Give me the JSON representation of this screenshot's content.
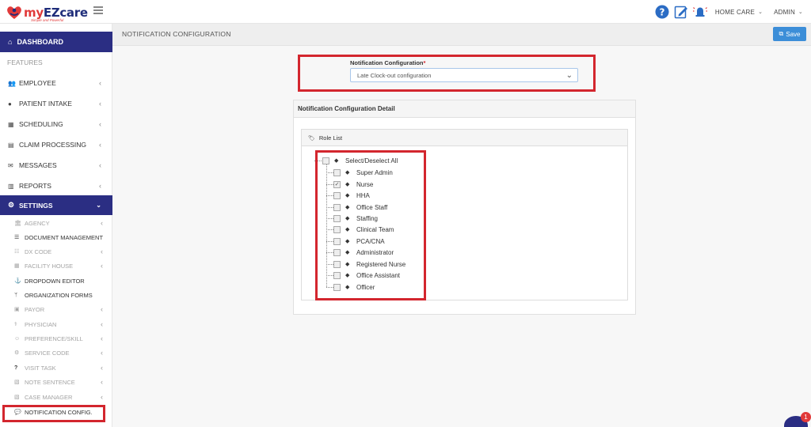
{
  "brand": {
    "my": "my",
    "name": "EZcare",
    "tagline": "Simple and Powerful"
  },
  "topbar": {
    "agency_menu": "HOME CARE",
    "user_menu": "ADMIN"
  },
  "sidebar": {
    "dashboard": "DASHBOARD",
    "features_label": "FEATURES",
    "items": [
      {
        "label": "EMPLOYEE"
      },
      {
        "label": "PATIENT INTAKE"
      },
      {
        "label": "SCHEDULING"
      },
      {
        "label": "CLAIM PROCESSING"
      },
      {
        "label": "MESSAGES"
      },
      {
        "label": "REPORTS"
      }
    ],
    "settings": "SETTINGS",
    "sub_items": [
      {
        "label": "AGENCY"
      },
      {
        "label": "DOCUMENT MANAGEMENT"
      },
      {
        "label": "DX CODE"
      },
      {
        "label": "FACILITY HOUSE"
      },
      {
        "label": "DROPDOWN EDITOR"
      },
      {
        "label": "ORGANIZATION FORMS"
      },
      {
        "label": "PAYOR"
      },
      {
        "label": "PHYSICIAN"
      },
      {
        "label": "PREFERENCE/SKILL"
      },
      {
        "label": "SERVICE CODE"
      },
      {
        "label": "VISIT TASK"
      },
      {
        "label": "NOTE SENTENCE"
      },
      {
        "label": "CASE MANAGER"
      },
      {
        "label": "NOTIFICATION CONFIG."
      }
    ]
  },
  "page": {
    "title": "NOTIFICATION CONFIGURATION",
    "save_label": "Save",
    "config_label": "Notification Configuration",
    "required_mark": "*",
    "config_value": "Late Clock-out configuration",
    "detail_title": "Notification Configuration Detail",
    "role_list_title": "Role List",
    "select_all_label": "Select/Deselect All",
    "roles": [
      {
        "label": "Super Admin",
        "checked": false
      },
      {
        "label": "Nurse",
        "checked": true
      },
      {
        "label": "HHA",
        "checked": false
      },
      {
        "label": "Office Staff",
        "checked": false
      },
      {
        "label": "Staffing",
        "checked": false
      },
      {
        "label": "Clinical Team",
        "checked": false
      },
      {
        "label": "PCA/CNA",
        "checked": false
      },
      {
        "label": "Administrator",
        "checked": false
      },
      {
        "label": "Registered Nurse",
        "checked": false
      },
      {
        "label": "Office Assistant",
        "checked": false
      },
      {
        "label": "Officer",
        "checked": false
      }
    ]
  },
  "chat": {
    "badge": "1"
  },
  "colors": {
    "primary": "#2b2e83",
    "accent": "#3c8ed8",
    "highlight": "#d3262e"
  }
}
